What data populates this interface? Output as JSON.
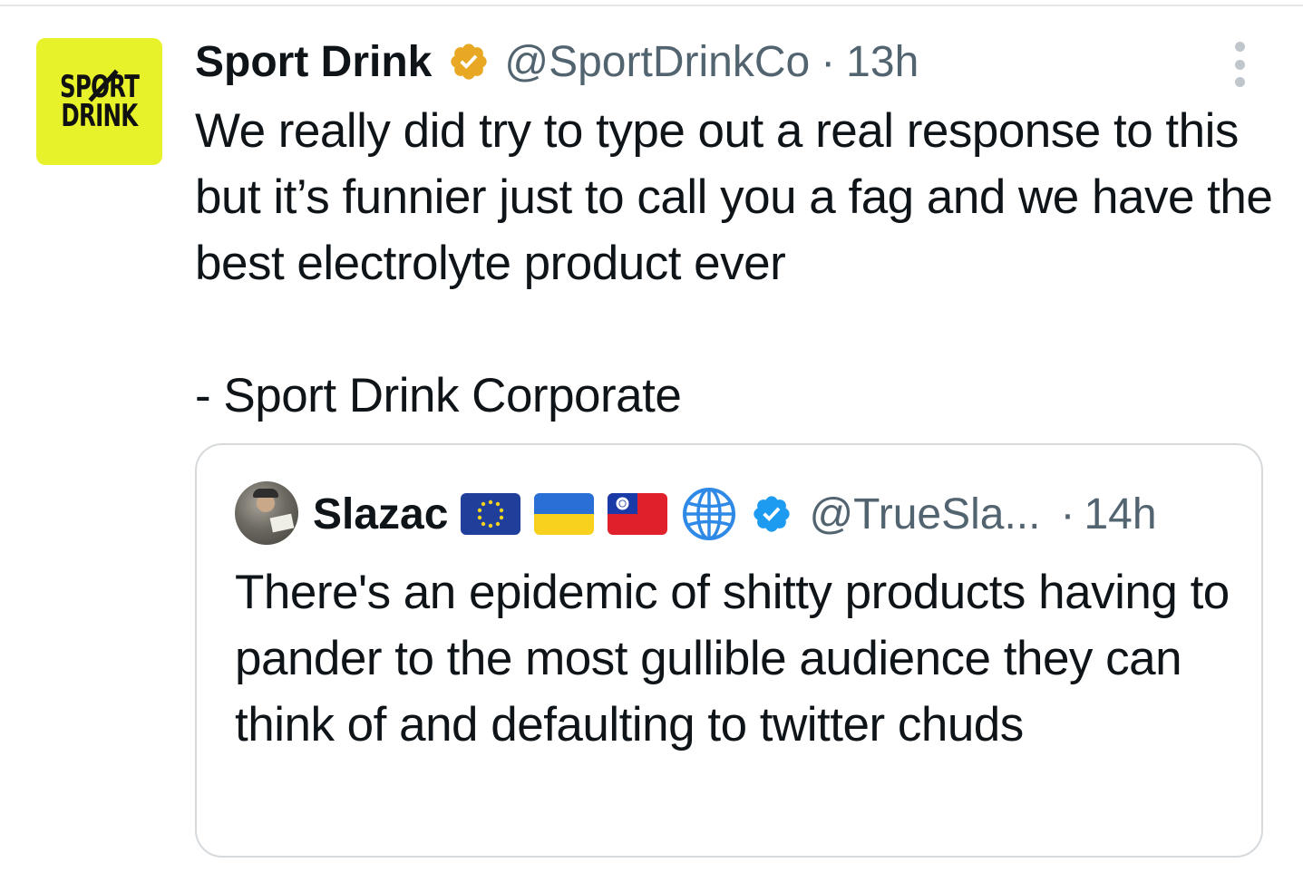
{
  "tweet": {
    "author_name": "Sport Drink",
    "author_handle": "@SportDrinkCo",
    "separator": "·",
    "time": "13h",
    "avatar_logo_lines": [
      "SPORT",
      "DRINK"
    ],
    "text": "We really did try to type out a real response to this but it’s funnier just to call you a fag and we have the best electrolyte product ever\n\n- Sport Drink Corporate",
    "verified_badge": "gold-verified-badge-icon",
    "more_icon": "more-options-icon"
  },
  "quoted_tweet": {
    "author_name": "Slazac",
    "author_handle": "@TrueSla...",
    "separator": "·",
    "time": "14h",
    "emoji_icons": [
      "eu-flag-icon",
      "ukraine-flag-icon",
      "taiwan-flag-icon",
      "globe-icon"
    ],
    "verified_badge": "blue-verified-badge-icon",
    "text": "There's an epidemic of shitty products having to pander to the most gullible audience they can think of and defaulting to twitter chuds"
  },
  "colors": {
    "text_primary": "#0f1419",
    "text_secondary": "#536471",
    "border": "#d6dadd",
    "avatar_bg": "#e8f22a",
    "gold_badge": "#e8a823",
    "blue_badge": "#1d9bf0"
  }
}
